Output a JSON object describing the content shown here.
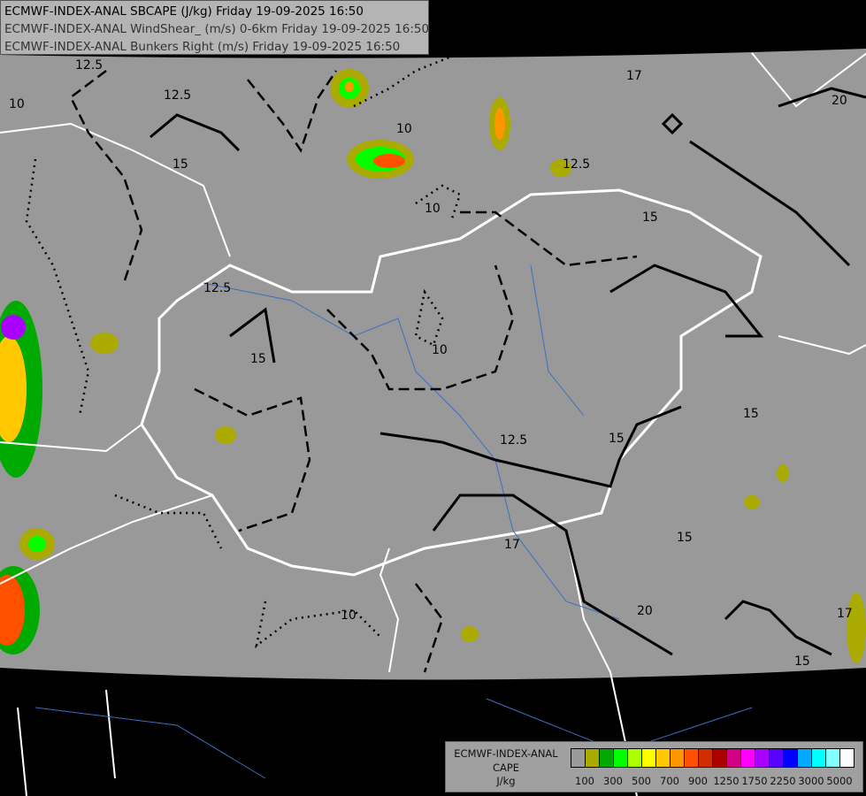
{
  "header": {
    "lines": [
      "ECMWF-INDEX-ANAL SBCAPE (J/kg) Friday 19-09-2025 16:50",
      "ECMWF-INDEX-ANAL WindShear_ (m/s) 0-6km Friday 19-09-2025 16:50",
      "ECMWF-INDEX-ANAL Bunkers Right (m/s) Friday 19-09-2025 16:50"
    ]
  },
  "legend": {
    "title_lines": [
      "ECMWF-INDEX-ANAL",
      "CAPE",
      "J/kg"
    ],
    "colors": [
      "#9a9a9a",
      "#aaaa00",
      "#00aa00",
      "#00ff00",
      "#aaff00",
      "#ffff00",
      "#ffc800",
      "#ff9600",
      "#ff5000",
      "#d22d00",
      "#aa0000",
      "#d20082",
      "#ff00ff",
      "#aa00ff",
      "#5a00ff",
      "#0000ff",
      "#00aaff",
      "#00ffff",
      "#82ffff",
      "#ffffff"
    ],
    "tick_labels": [
      "100",
      "300",
      "500",
      "700",
      "900",
      "1250",
      "1750",
      "2250",
      "3000",
      "5000"
    ]
  },
  "contour_labels": [
    "12.5",
    "10",
    "12.5",
    "15",
    "10",
    "12.5",
    "10",
    "15",
    "17",
    "20",
    "15",
    "12.5",
    "10",
    "15",
    "12.5",
    "15",
    "17",
    "20",
    "15",
    "17",
    "10",
    "15"
  ],
  "colors": {
    "map_fill": "#999999",
    "background": "#000000",
    "border": "#ffffff",
    "river": "#3a6fc0",
    "contour": "#000000"
  }
}
